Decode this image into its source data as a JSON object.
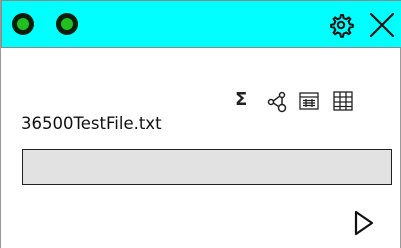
{
  "titlebar": {
    "color": "#00ffff",
    "status_dots": [
      {
        "icon": "green-dot-icon",
        "color": "#20c020"
      },
      {
        "icon": "green-dot-icon",
        "color": "#20c020"
      }
    ],
    "settings_icon": "gear-icon",
    "close_icon": "close-icon"
  },
  "toolbar": {
    "sum_label": "Σ",
    "icons": [
      "sigma-icon",
      "tree-icon",
      "list-icon",
      "grid-icon"
    ]
  },
  "file": {
    "name": "36500TestFile.txt",
    "progress": 0
  },
  "controls": {
    "play_icon": "play-icon"
  }
}
